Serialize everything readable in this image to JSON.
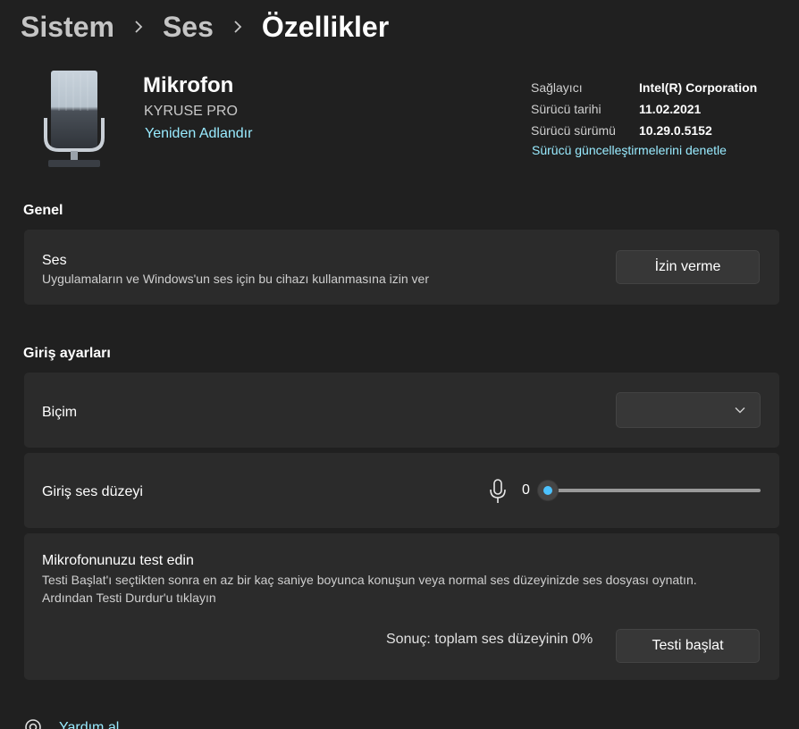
{
  "breadcrumb": {
    "items": [
      "Sistem",
      "Ses",
      "Özellikler"
    ]
  },
  "device": {
    "icon": "microphone-device-icon",
    "name": "Mikrofon",
    "model": "KYRUSE PRO",
    "rename_link": "Yeniden Adlandır"
  },
  "driver": {
    "provider_label": "Sağlayıcı",
    "provider_value": "Intel(R) Corporation",
    "date_label": "Sürücü tarihi",
    "date_value": "11.02.2021",
    "version_label": "Sürücü sürümü",
    "version_value": "10.29.0.5152",
    "update_link": "Sürücü güncelleştirmelerini denetle"
  },
  "general": {
    "section_title": "Genel",
    "audio_card": {
      "title": "Ses",
      "description": "Uygulamaların ve Windows'un ses için bu cihazı kullanmasına izin ver",
      "button_label": "İzin verme"
    }
  },
  "input_settings": {
    "section_title": "Giriş ayarları",
    "format": {
      "label": "Biçim",
      "selected_value": ""
    },
    "input_volume": {
      "label": "Giriş ses düzeyi",
      "value": "0",
      "level_fraction": 0
    },
    "test": {
      "title": "Mikrofonunuzu test edin",
      "description_line1": "Testi Başlat'ı seçtikten sonra en az bir kaç saniye boyunca konuşun veya normal ses düzeyinizde ses dosyası oynatın.",
      "description_line2": "Ardından Testi Durdur'u tıklayın",
      "result": "Sonuç: toplam ses düzeyinin 0%",
      "button_label": "Testi başlat"
    }
  },
  "help": {
    "label": "Yardım al",
    "icon": "help-icon"
  },
  "colors": {
    "background": "#202020",
    "card": "#2b2b2b",
    "accent": "#4cc2ff",
    "link": "#99ebff"
  }
}
